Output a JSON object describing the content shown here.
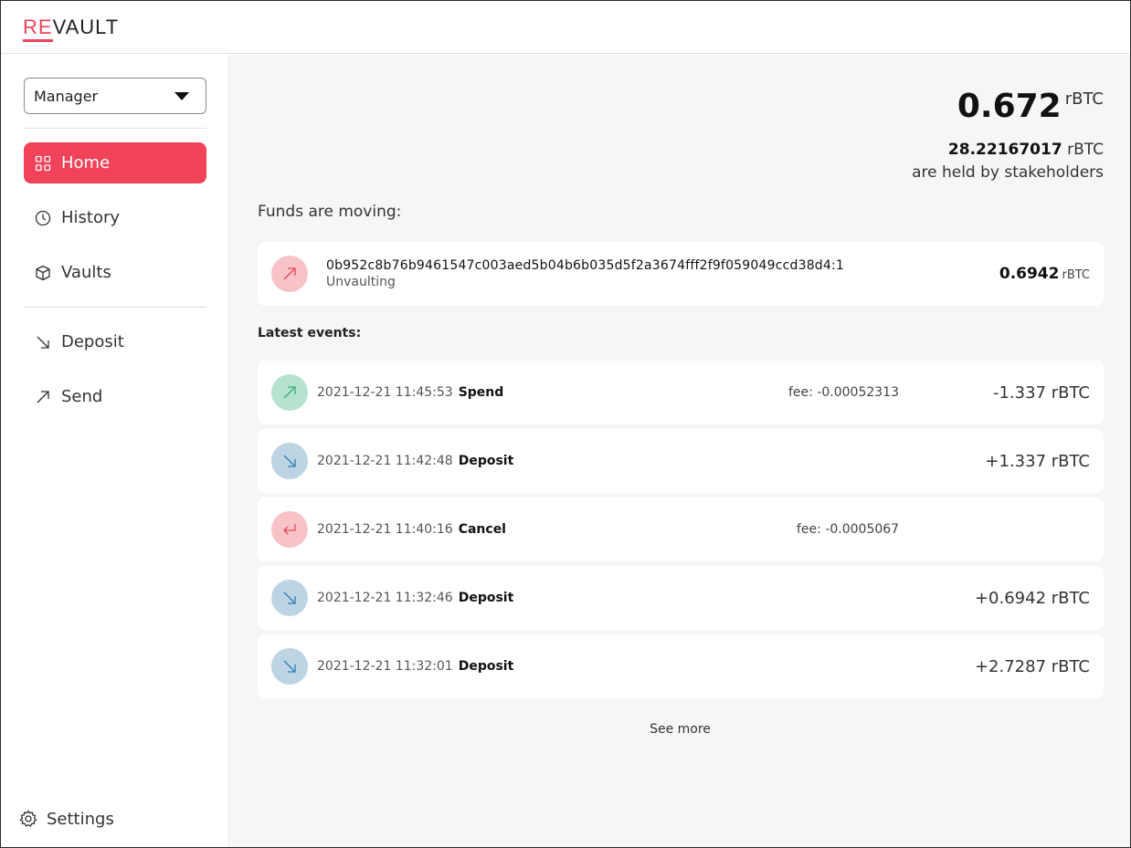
{
  "header": {
    "logo_re": "RE",
    "logo_vault": "VAULT"
  },
  "sidebar": {
    "role": "Manager",
    "items": [
      {
        "label": "Home",
        "icon": "grid-icon",
        "active": true
      },
      {
        "label": "History",
        "icon": "clock-icon"
      },
      {
        "label": "Vaults",
        "icon": "cube-icon"
      },
      {
        "label": "Deposit",
        "icon": "arrow-down-right-icon"
      },
      {
        "label": "Send",
        "icon": "arrow-up-right-icon"
      }
    ],
    "settings_label": "Settings"
  },
  "balance": {
    "amount": "0.672",
    "unit": "rBTC",
    "held_amount": "28.22167017",
    "held_unit": "rBTC",
    "held_text": "are held by stakeholders"
  },
  "moving": {
    "title": "Funds are moving:",
    "txid": "0b952c8b76b9461547c003aed5b04b6b035d5f2a3674fff2f9f059049ccd38d4:1",
    "status": "Unvaulting",
    "amount": "0.6942",
    "unit": "rBTC"
  },
  "events": {
    "title": "Latest events:",
    "items": [
      {
        "date": "2021-12-21 11:45:53",
        "type": "Spend",
        "fee": "fee: -0.00052313",
        "amount": "-1.337 rBTC",
        "kind": "spend"
      },
      {
        "date": "2021-12-21 11:42:48",
        "type": "Deposit",
        "fee": "",
        "amount": "+1.337 rBTC",
        "kind": "deposit"
      },
      {
        "date": "2021-12-21 11:40:16",
        "type": "Cancel",
        "fee": "fee: -0.0005067",
        "amount": "",
        "kind": "cancel"
      },
      {
        "date": "2021-12-21 11:32:46",
        "type": "Deposit",
        "fee": "",
        "amount": "+0.6942 rBTC",
        "kind": "deposit"
      },
      {
        "date": "2021-12-21 11:32:01",
        "type": "Deposit",
        "fee": "",
        "amount": "+2.7287 rBTC",
        "kind": "deposit"
      }
    ],
    "see_more": "See more"
  },
  "colors": {
    "accent": "#f04359",
    "red_circle": "#f8c3c8",
    "green_circle": "#b6e3cf",
    "blue_circle": "#bcd4e3",
    "green_arrow": "#3aae7a",
    "blue_arrow": "#2f7fb5",
    "red_arrow": "#e5485c"
  }
}
